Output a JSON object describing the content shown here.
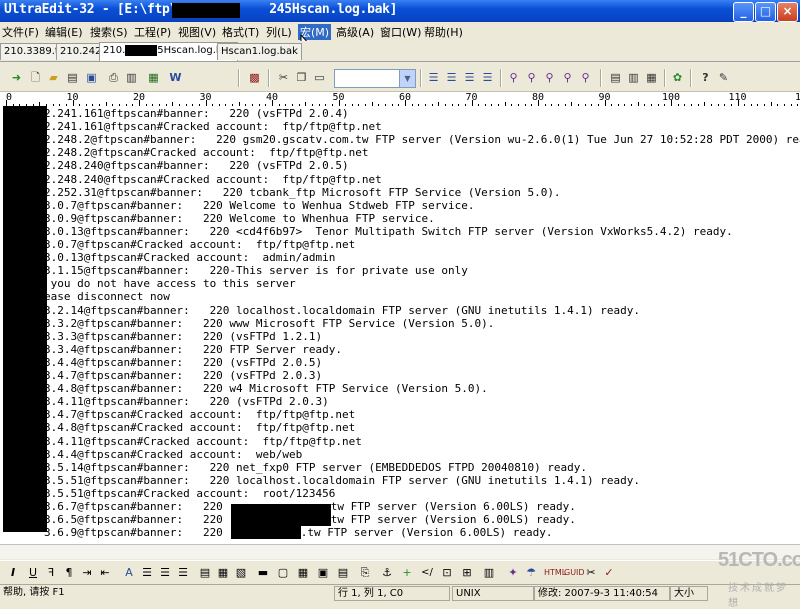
{
  "window": {
    "title_prefix": "UltraEdit-32 - [E:\\ftp\\210.",
    "title_suffix": "245Hscan.log.bak]",
    "min_label": "_",
    "max_label": "□",
    "close_label": "×"
  },
  "menu": [
    {
      "label": "文件(F)"
    },
    {
      "label": "编辑(E)"
    },
    {
      "label": "搜索(S)"
    },
    {
      "label": "工程(P)"
    },
    {
      "label": "视图(V)"
    },
    {
      "label": "格式(T)"
    },
    {
      "label": "列(L)"
    },
    {
      "label": "宏(M)"
    },
    {
      "label": "高级(A)"
    },
    {
      "label": "窗口(W)"
    },
    {
      "label": "帮助(H)"
    }
  ],
  "tabs": [
    {
      "label": "210.3389.txt"
    },
    {
      "label": "210.242"
    },
    {
      "label_prefix": "210.",
      "label_suffix": "5Hscan.log.bak"
    },
    {
      "label": "Hscan1.log.bak"
    }
  ],
  "toolbar": {
    "font_combo_value": "",
    "icons": [
      "arrow-right-icon",
      "new-file-icon",
      "open-file-icon",
      "close-file-icon",
      "save-icon",
      "print-icon",
      "print-preview-icon",
      "html-preview-icon",
      "web-icon",
      "word-wrap-icon",
      "cut-icon",
      "copy-icon",
      "paste-icon",
      "align-left-icon",
      "align-center-icon",
      "align-right-icon",
      "justify-icon",
      "find-icon",
      "find-next-icon",
      "find-prev-icon",
      "replace-icon",
      "find-files-icon",
      "window-tile-icon",
      "window-cascade-icon",
      "window-list-icon",
      "ftp-icon",
      "help-icon",
      "context-help-icon"
    ]
  },
  "ruler": {
    "labels": [
      "0",
      "10",
      "20",
      "30",
      "40",
      "50",
      "60",
      "70",
      "80",
      "90",
      "100",
      "110",
      "120"
    ]
  },
  "lines": [
    "2.241.161@ftpscan#banner:   220 (vsFTPd 2.0.4)",
    "2.241.161@ftpscan#Cracked account:  ftp/ftp@ftp.net",
    "2.248.2@ftpscan#banner:   220 gsm20.gscatv.com.tw FTP server (Version wu-2.6.0(1) Tue Jun 27 10:52:28 PDT 2000) read",
    "2.248.2@ftpscan#Cracked account:  ftp/ftp@ftp.net",
    "2.248.240@ftpscan#banner:   220 (vsFTPd 2.0.5)",
    "2.248.240@ftpscan#Cracked account:  ftp/ftp@ftp.net",
    "2.252.31@ftpscan#banner:   220 tcbank_ftp Microsoft FTP Service (Version 5.0).",
    "3.0.7@ftpscan#banner:   220 Welcome to Wenhua Stdweb FTP service.",
    "3.0.9@ftpscan#banner:   220 Welcome to Whenhua FTP service.",
    "3.0.13@ftpscan#banner:   220 <cd4f6b97>  Tenor Multipath Switch FTP server (Version VxWorks5.4.2) ready.",
    "3.0.7@ftpscan#Cracked account:  ftp/ftp@ftp.net",
    "3.0.13@ftpscan#Cracked account:  admin/admin",
    "3.1.15@ftpscan#banner:   220-This server is for private use only",
    " you do not have access to this server",
    "ease disconnect now",
    "3.2.14@ftpscan#banner:   220 localhost.localdomain FTP server (GNU inetutils 1.4.1) ready.",
    "3.3.2@ftpscan#banner:   220 www Microsoft FTP Service (Version 5.0).",
    "3.3.3@ftpscan#banner:   220 (vsFTPd 1.2.1)",
    "3.3.4@ftpscan#banner:   220 FTP Server ready.",
    "3.4.4@ftpscan#banner:   220 (vsFTPd 2.0.5)",
    "3.4.7@ftpscan#banner:   220 (vsFTPd 2.0.3)",
    "3.4.8@ftpscan#banner:   220 w4 Microsoft FTP Service (Version 5.0).",
    "3.4.11@ftpscan#banner:   220 (vsFTPd 2.0.3)",
    "3.4.7@ftpscan#Cracked account:  ftp/ftp@ftp.net",
    "3.4.8@ftpscan#Cracked account:  ftp/ftp@ftp.net",
    "3.4.11@ftpscan#Cracked account:  ftp/ftp@ftp.net",
    "3.4.4@ftpscan#Cracked account:  web/web",
    "3.5.14@ftpscan#banner:   220 net_fxp0 FTP server (EMBEDDEDOS FTPD 20040810) ready.",
    "3.5.51@ftpscan#banner:   220 localhost.localdomain FTP server (GNU inetutils 1.4.1) ready.",
    "3.5.51@ftpscan#Cracked account:  root/123456",
    "3.6.7@ftpscan#banner:   220 ",
    "3.6.5@ftpscan#banner:   220 ",
    "3.6.9@ftpscan#banner:   220 "
  ],
  "line_tails": {
    "30": "tw FTP server (Version 6.00LS) ready.",
    "31": "tw FTP server (Version 6.00LS) ready.",
    "32": ".tw FTP server (Version 6.00LS) ready."
  },
  "status": {
    "help": "帮助, 请按 F1",
    "position": "行 1, 列 1, C0",
    "format": "UNIX",
    "modified": "修改:   2007-9-3 11:40:54",
    "size": "大小"
  },
  "watermark": {
    "logo": "51CTO.com",
    "tagline": "技术成就梦想"
  }
}
